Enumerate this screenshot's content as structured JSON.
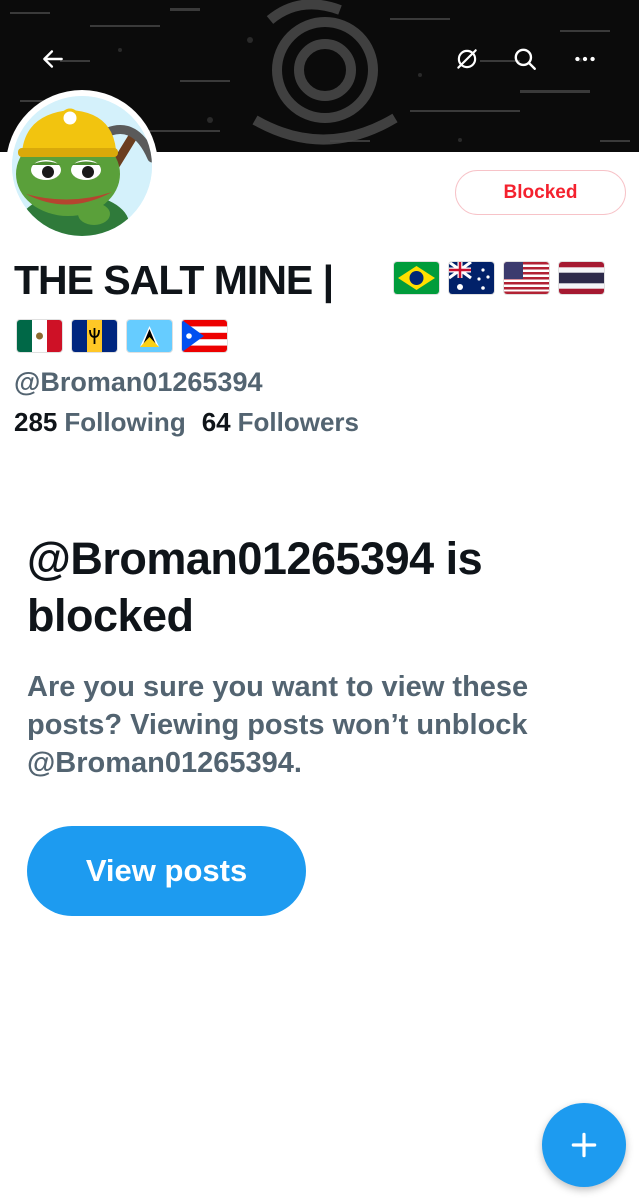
{
  "header": {
    "back_icon": "arrow-left-icon",
    "grok_icon": "grok-icon",
    "search_icon": "search-icon",
    "more_icon": "more-horizontal-icon"
  },
  "profile": {
    "display_name": "THE SALT MINE |",
    "flags": [
      "Brazil",
      "Australia",
      "United States",
      "Thailand",
      "Mexico",
      "Barbados",
      "Saint Lucia",
      "Puerto Rico"
    ],
    "handle": "@Broman01265394",
    "following_count": "285",
    "following_label": "Following",
    "followers_count": "64",
    "followers_label": "Followers",
    "blocked_button_label": "Blocked"
  },
  "block_notice": {
    "title": "@Broman01265394 is blocked",
    "description": "Are you sure you want to view these posts? Viewing posts won’t unblock @Broman01265394.",
    "view_posts_label": "View posts"
  },
  "fab": {
    "icon": "plus-icon"
  },
  "colors": {
    "accent": "#1d9bf0",
    "blocked_red": "#f4212e",
    "secondary_text": "#536471",
    "primary_text": "#0f1419"
  }
}
